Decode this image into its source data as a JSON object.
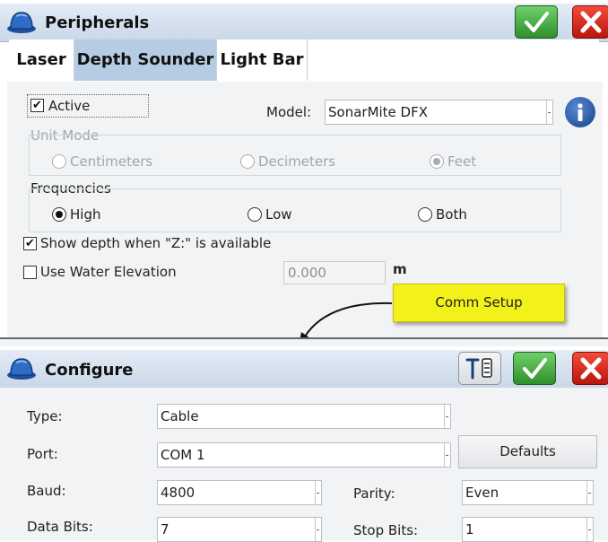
{
  "peripherals": {
    "title": "Peripherals",
    "ok_icon": "checkmark-icon",
    "close_icon": "close-icon",
    "tabs": [
      {
        "label": "Laser",
        "active": false
      },
      {
        "label": "Depth Sounder",
        "active": true
      },
      {
        "label": "Light Bar",
        "active": false
      }
    ],
    "active": {
      "label": "Active",
      "checked": true
    },
    "model": {
      "label": "Model:",
      "value": "SonarMite DFX"
    },
    "unit_mode": {
      "label": "Unit Mode",
      "options": [
        "Centimeters",
        "Decimeters",
        "Feet"
      ],
      "selected": "Feet"
    },
    "frequencies": {
      "label": "Frequencies",
      "options": [
        "High",
        "Low",
        "Both"
      ],
      "selected": "High"
    },
    "show_depth": {
      "label": "Show depth when \"Z:\" is available",
      "checked": true
    },
    "water_elevation": {
      "label": "Use Water Elevation",
      "checked": false,
      "value": "0.000",
      "unit": "m"
    },
    "comm_setup": "Comm Setup"
  },
  "configure": {
    "title": "Configure",
    "type": {
      "label": "Type:",
      "value": "Cable"
    },
    "port": {
      "label": "Port:",
      "value": "COM 1"
    },
    "defaults": "Defaults",
    "baud": {
      "label": "Baud:",
      "value": "4800"
    },
    "parity": {
      "label": "Parity:",
      "value": "Even"
    },
    "data_bits": {
      "label": "Data Bits:",
      "value": "7"
    },
    "stop_bits": {
      "label": "Stop Bits:",
      "value": "1"
    }
  },
  "colors": {
    "accent_tab": "#b6cce3",
    "ok_green": "#2f8f2c",
    "close_red": "#b8160e",
    "comm_yellow": "#f4f01a"
  }
}
